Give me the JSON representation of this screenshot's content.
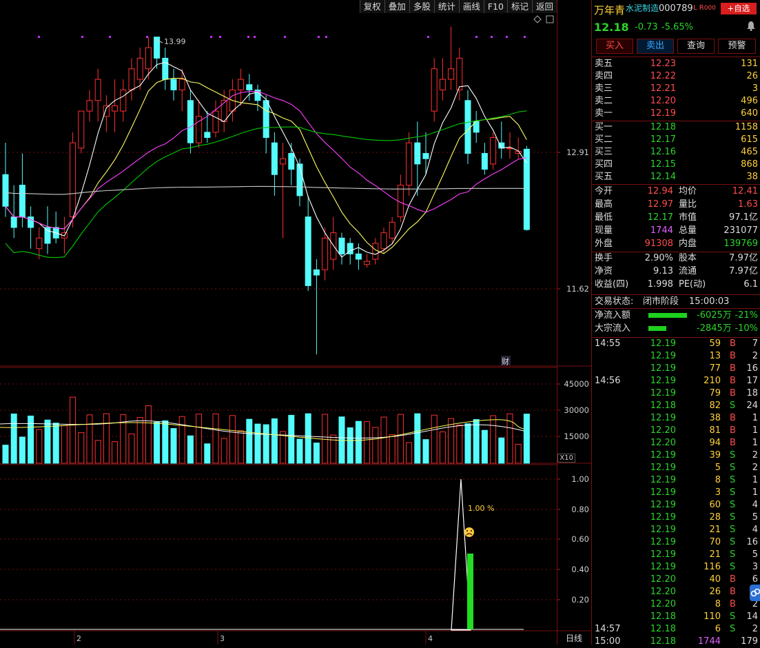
{
  "toolbar": [
    "复权",
    "叠加",
    "多股",
    "统计",
    "画线",
    "F10",
    "标记",
    "返回"
  ],
  "stock": {
    "name": "万年青",
    "sector": "水泥制造",
    "code": "000789",
    "flag": "L R",
    "level": "000",
    "add_label": "+自选",
    "price": "12.18",
    "change": "-0.73",
    "pct": "-5.65%"
  },
  "actions": {
    "buy": "买入",
    "sell": "卖出",
    "query": "查询",
    "alert": "预警"
  },
  "asks": [
    {
      "l": "卖五",
      "p": "12.23",
      "v": "131"
    },
    {
      "l": "卖四",
      "p": "12.22",
      "v": "26"
    },
    {
      "l": "卖三",
      "p": "12.21",
      "v": "3"
    },
    {
      "l": "卖二",
      "p": "12.20",
      "v": "496"
    },
    {
      "l": "卖一",
      "p": "12.19",
      "v": "640"
    }
  ],
  "bids": [
    {
      "l": "买一",
      "p": "12.18",
      "v": "1158"
    },
    {
      "l": "买二",
      "p": "12.17",
      "v": "615"
    },
    {
      "l": "买三",
      "p": "12.16",
      "v": "465"
    },
    {
      "l": "买四",
      "p": "12.15",
      "v": "868"
    },
    {
      "l": "买五",
      "p": "12.14",
      "v": "38"
    }
  ],
  "stats": [
    {
      "l1": "今开",
      "v1": "12.94",
      "c1": "red",
      "l2": "均价",
      "v2": "12.41",
      "c2": "red"
    },
    {
      "l1": "最高",
      "v1": "12.97",
      "c1": "red",
      "l2": "量比",
      "v2": "1.63",
      "c2": "red"
    },
    {
      "l1": "最低",
      "v1": "12.17",
      "c1": "green",
      "l2": "市值",
      "v2": "97.1亿",
      "c2": "white"
    },
    {
      "l1": "现量",
      "v1": "1744",
      "c1": "purple",
      "l2": "总量",
      "v2": "231077",
      "c2": "white"
    },
    {
      "l1": "外盘",
      "v1": "91308",
      "c1": "red",
      "l2": "内盘",
      "v2": "139769",
      "c2": "green"
    }
  ],
  "stats2": [
    {
      "l1": "换手",
      "v1": "2.90%",
      "l2": "股本",
      "v2": "7.97亿"
    },
    {
      "l1": "净资",
      "v1": "9.13",
      "l2": "流通",
      "v2": "7.97亿"
    },
    {
      "l1": "收益(四)",
      "v1": "1.998",
      "l2": "PE(动)",
      "v2": "6.1"
    }
  ],
  "status": {
    "label": "交易状态:",
    "value": "闭市阶段",
    "time": "15:00:03"
  },
  "flows": [
    {
      "l": "净流入额",
      "v": "-6025万",
      "p": "-21%",
      "w": 56
    },
    {
      "l": "大宗流入",
      "v": "-2845万",
      "p": "-10%",
      "w": 26
    }
  ],
  "ticks": [
    {
      "t": "14:55",
      "p": "12.19",
      "v": "59",
      "s": "B",
      "n": "7"
    },
    {
      "t": "",
      "p": "12.19",
      "v": "13",
      "s": "B",
      "n": "2"
    },
    {
      "t": "",
      "p": "12.19",
      "v": "77",
      "s": "B",
      "n": "16"
    },
    {
      "t": "14:56",
      "p": "12.19",
      "v": "210",
      "s": "B",
      "n": "17"
    },
    {
      "t": "",
      "p": "12.19",
      "v": "79",
      "s": "B",
      "n": "18"
    },
    {
      "t": "",
      "p": "12.18",
      "v": "82",
      "s": "S",
      "n": "24"
    },
    {
      "t": "",
      "p": "12.19",
      "v": "38",
      "s": "B",
      "n": "1"
    },
    {
      "t": "",
      "p": "12.20",
      "v": "81",
      "s": "B",
      "n": "1"
    },
    {
      "t": "",
      "p": "12.20",
      "v": "94",
      "s": "B",
      "n": "1"
    },
    {
      "t": "",
      "p": "12.19",
      "v": "39",
      "s": "S",
      "n": "2"
    },
    {
      "t": "",
      "p": "12.19",
      "v": "5",
      "s": "S",
      "n": "2"
    },
    {
      "t": "",
      "p": "12.19",
      "v": "8",
      "s": "S",
      "n": "1"
    },
    {
      "t": "",
      "p": "12.19",
      "v": "3",
      "s": "S",
      "n": "1"
    },
    {
      "t": "",
      "p": "12.19",
      "v": "60",
      "s": "S",
      "n": "4"
    },
    {
      "t": "",
      "p": "12.19",
      "v": "28",
      "s": "S",
      "n": "5"
    },
    {
      "t": "",
      "p": "12.19",
      "v": "21",
      "s": "S",
      "n": "4"
    },
    {
      "t": "",
      "p": "12.19",
      "v": "70",
      "s": "S",
      "n": "16"
    },
    {
      "t": "",
      "p": "12.19",
      "v": "21",
      "s": "S",
      "n": "5"
    },
    {
      "t": "",
      "p": "12.19",
      "v": "116",
      "s": "S",
      "n": "3"
    },
    {
      "t": "",
      "p": "12.20",
      "v": "40",
      "s": "B",
      "n": "6"
    },
    {
      "t": "",
      "p": "12.20",
      "v": "26",
      "s": "B",
      "n": "6"
    },
    {
      "t": "",
      "p": "12.20",
      "v": "8",
      "s": "B",
      "n": "2"
    },
    {
      "t": "",
      "p": "12.18",
      "v": "110",
      "s": "S",
      "n": "14"
    },
    {
      "t": "14:57",
      "p": "12.18",
      "v": "6",
      "s": "S",
      "n": "2"
    },
    {
      "t": "15:00",
      "p": "12.18",
      "v": "1744",
      "s": "",
      "n": "179"
    }
  ],
  "axis": {
    "price": [
      {
        "v": "12.91",
        "y": 221
      },
      {
        "v": "11.62",
        "y": 419
      }
    ],
    "vol": [
      {
        "v": "45000",
        "y": 557
      },
      {
        "v": "30000",
        "y": 595
      },
      {
        "v": "15000",
        "y": 633
      }
    ],
    "vol_unit": "X10",
    "ind": [
      {
        "v": "1.00",
        "y": 695
      },
      {
        "v": "0.80",
        "y": 739
      },
      {
        "v": "0.60",
        "y": 782
      },
      {
        "v": "0.40",
        "y": 826
      },
      {
        "v": "0.20",
        "y": 870
      }
    ],
    "period": "日线"
  },
  "chart_labels": {
    "high": "13.99",
    "fin": "财",
    "pct": "1.00 %",
    "months": [
      "2",
      "3",
      "4"
    ]
  },
  "colors": {
    "up": "#ff3030",
    "down": "#54fcfc",
    "ma5": "#ffffff",
    "ma10": "#ffff60",
    "ma20": "#ff40ff",
    "ma60": "#00cc00",
    "ma120": "#cccccc"
  },
  "chart_data": {
    "type": "candlestick",
    "price_ticks": [
      "12.91",
      "11.62"
    ],
    "high_label": "13.99",
    "volume_ticks": [
      "45000",
      "30000",
      "15000"
    ],
    "indicator_ticks": [
      "1.00",
      "0.80",
      "0.60",
      "0.40",
      "0.20"
    ],
    "indicator_value": "1.00 %",
    "x_ticks": [
      "2",
      "3",
      "4"
    ]
  }
}
